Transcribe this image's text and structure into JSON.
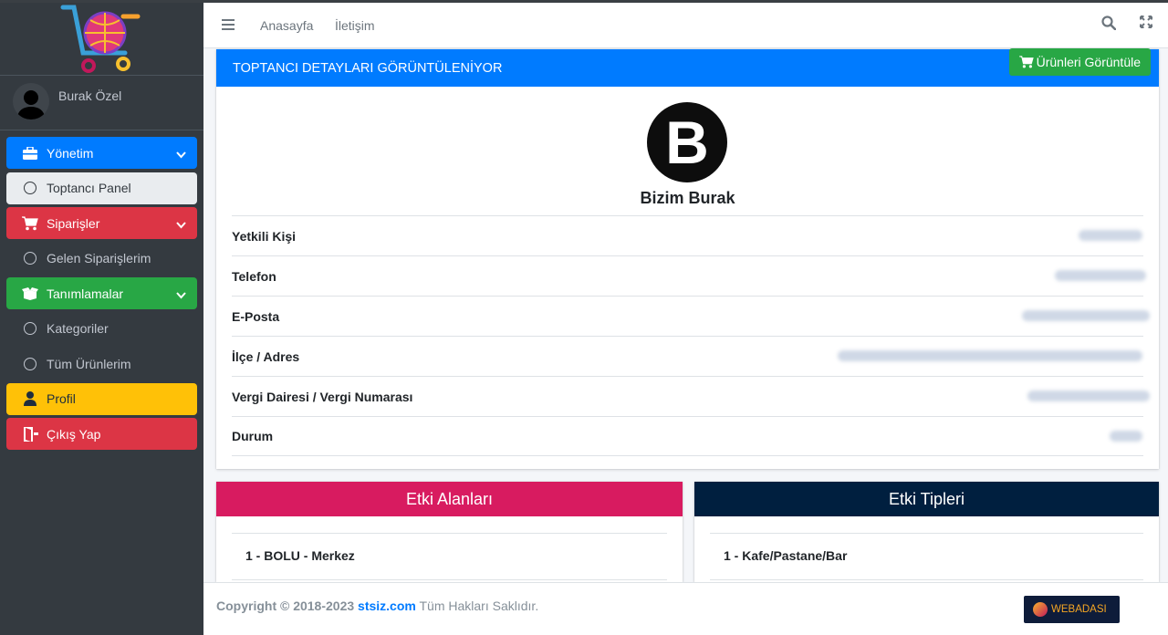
{
  "sidebar": {
    "user_name": "Burak Özel",
    "items": [
      {
        "label": "Yönetim",
        "icon": "briefcase-icon",
        "color": "#007bff"
      },
      {
        "label": "Toptancı Panel",
        "icon": "circle-icon"
      },
      {
        "label": "Siparişler",
        "icon": "cart-icon",
        "color": "#dc3545"
      },
      {
        "label": "Gelen Siparişlerim",
        "icon": "circle-icon"
      },
      {
        "label": "Tanımlamalar",
        "icon": "box-open-icon",
        "color": "#28a745"
      },
      {
        "label": "Kategoriler",
        "icon": "circle-icon"
      },
      {
        "label": "Tüm Ürünlerim",
        "icon": "circle-icon"
      },
      {
        "label": "Profil",
        "icon": "user-icon",
        "color": "#ffc107"
      },
      {
        "label": "Çıkış Yap",
        "icon": "door-exit-icon",
        "color": "#dc3545"
      }
    ]
  },
  "navbar": {
    "links": [
      "Anasayfa",
      "İletişim"
    ]
  },
  "card": {
    "header": "TOPTANCI DETAYLARI GÖRÜNTÜLENİYOR",
    "products_button": "Ürünleri Görüntüle",
    "brand_letter": "B",
    "brand_name": "Bizim Burak",
    "rows": [
      {
        "label": "Yetkili Kişi"
      },
      {
        "label": "Telefon"
      },
      {
        "label": "E-Posta"
      },
      {
        "label": "İlçe / Adres"
      },
      {
        "label": "Vergi Dairesi / Vergi Numarası"
      },
      {
        "label": "Durum"
      }
    ]
  },
  "areas": {
    "title": "Etki Alanları",
    "items": [
      "1 - BOLU - Merkez"
    ],
    "color": "#d81b60"
  },
  "types": {
    "title": "Etki Tipleri",
    "items": [
      "1 - Kafe/Pastane/Bar"
    ],
    "color": "#001f3f"
  },
  "footer": {
    "copyright": "Copyright © 2018-2023",
    "site": "stsiz.com",
    "rights": "Tüm Hakları Saklıdır.",
    "badge": "WEBADASI"
  }
}
